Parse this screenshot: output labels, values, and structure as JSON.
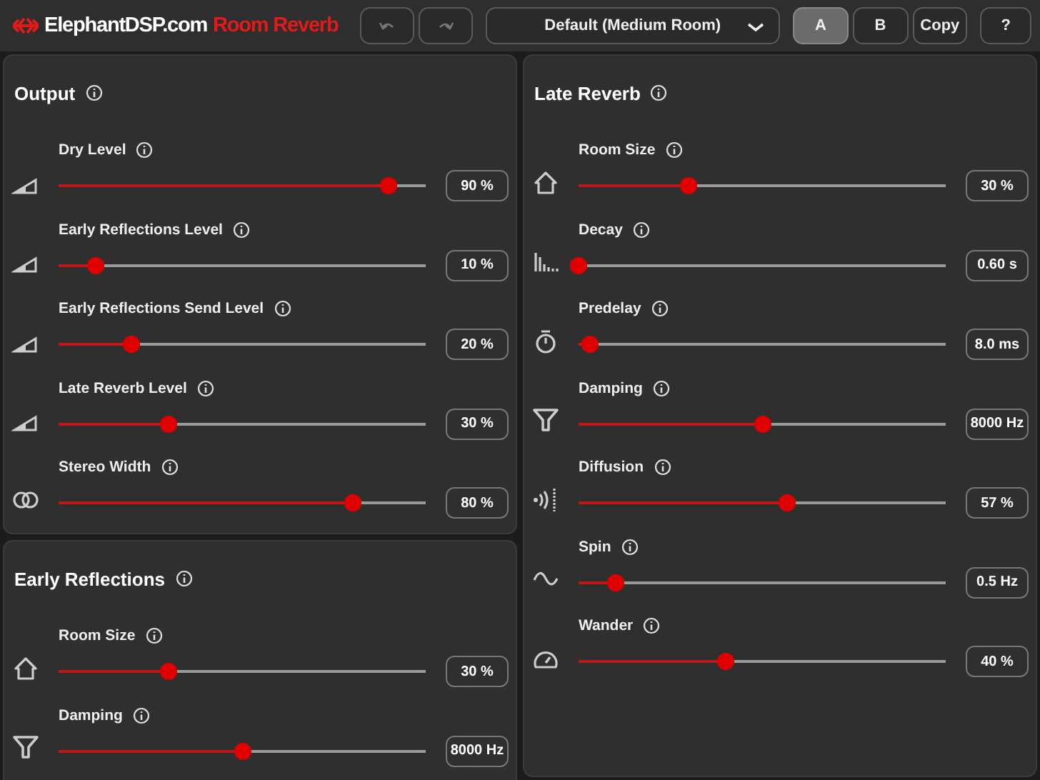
{
  "header": {
    "brand": "ElephantDSP.com",
    "product": "Room Reverb",
    "preset": "Default (Medium Room)",
    "ab": [
      {
        "label": "A",
        "selected": true
      },
      {
        "label": "B",
        "selected": false
      }
    ],
    "copy": "Copy",
    "help": "?"
  },
  "left_column": [
    {
      "title": "Output",
      "params": [
        {
          "kind": "level",
          "label": "Dry Level",
          "level": 0.9,
          "value": "90 %"
        },
        {
          "kind": "level",
          "label": "Early Reflections Level",
          "level": 0.1,
          "value": "10 %"
        },
        {
          "kind": "level",
          "label": "Early Reflections Send Level",
          "level": 0.2,
          "value": "20 %"
        },
        {
          "kind": "level",
          "label": "Late Reverb Level",
          "level": 0.3,
          "value": "30 %"
        },
        {
          "kind": "width",
          "label": "Stereo Width",
          "level": 0.8,
          "value": "80 %"
        }
      ]
    },
    {
      "title": "Early Reflections",
      "params": [
        {
          "kind": "room",
          "label": "Room Size",
          "level": 0.3,
          "value": "30 %"
        },
        {
          "kind": "filter",
          "label": "Damping",
          "level": 0.5,
          "value": "8000 Hz"
        }
      ]
    }
  ],
  "right_column": [
    {
      "title": "Late Reverb",
      "params": [
        {
          "kind": "room",
          "label": "Room Size",
          "level": 0.3,
          "value": "30 %"
        },
        {
          "kind": "decay",
          "label": "Decay",
          "level": 0.0,
          "value": "0.60 s"
        },
        {
          "kind": "timer",
          "label": "Predelay",
          "level": 0.03,
          "value": "8.0 ms"
        },
        {
          "kind": "filter",
          "label": "Damping",
          "level": 0.5,
          "value": "8000 Hz"
        },
        {
          "kind": "diffusion",
          "label": "Diffusion",
          "level": 0.57,
          "value": "57 %"
        },
        {
          "kind": "wave",
          "label": "Spin",
          "level": 0.1,
          "value": "0.5 Hz"
        },
        {
          "kind": "gauge",
          "label": "Wander",
          "level": 0.4,
          "value": "40 %"
        }
      ]
    }
  ]
}
